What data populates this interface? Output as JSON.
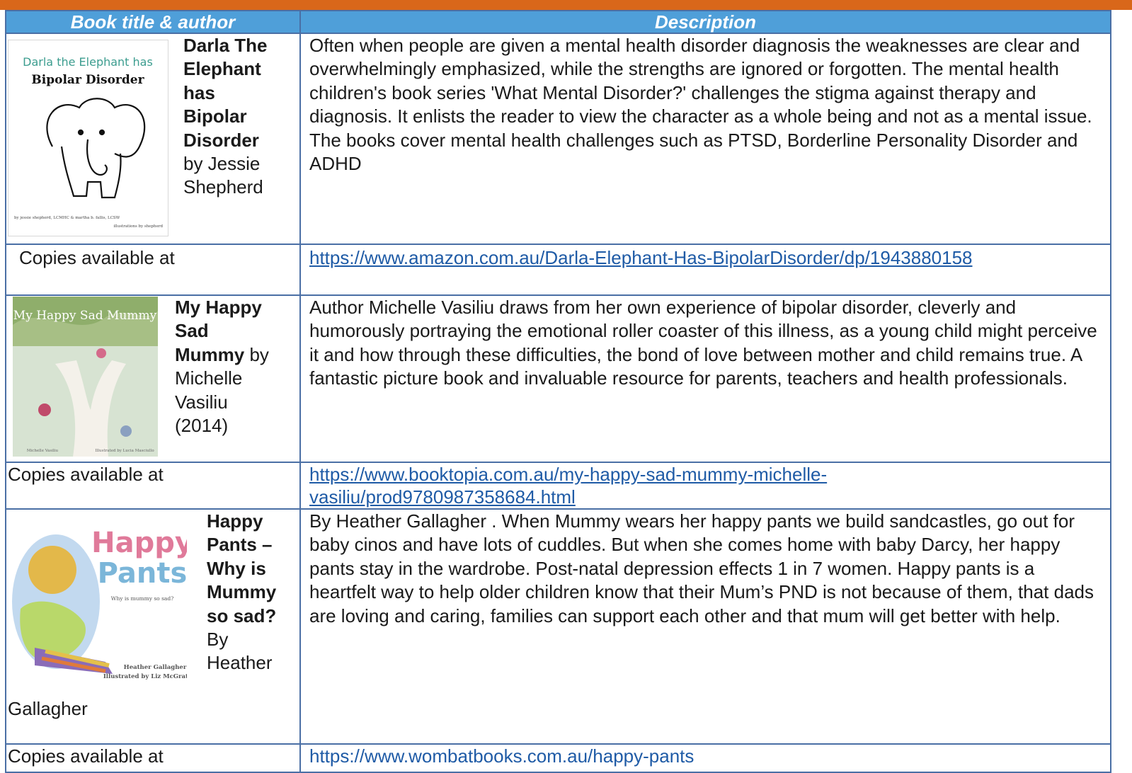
{
  "header": {
    "col1": "Book title & author",
    "col2": "Description"
  },
  "books": [
    {
      "cover": {
        "line1": "Darla the Elephant has",
        "line2": "Bipolar Disorder",
        "credit_left": "by jessie shepherd, LCMHC & martha b. fallis, LCSW",
        "credit_right": "illustrations by shepherd"
      },
      "title_lines": [
        "Darla The",
        "Elephant",
        "has",
        "Bipolar",
        "Disorder"
      ],
      "author_lines": [
        "by Jessie",
        "Shepherd"
      ],
      "description": "Often when people are given a mental health disorder diagnosis the weaknesses are clear and overwhelmingly emphasized, while the strengths are ignored or forgotten. The mental health children's book series 'What Mental Disorder?' challenges the stigma against therapy and diagnosis. It enlists the reader to view the character as a whole being and not as a mental issue. The books cover mental health challenges such as PTSD, Borderline Personality Disorder and ADHD",
      "copies_label": "Copies available at",
      "link": "https://www.amazon.com.au/Darla-Elephant-Has-BipolarDisorder/dp/1943880158"
    },
    {
      "cover": {
        "title": "My Happy Sad Mummy",
        "author": "Michelle Vasiliu",
        "illustrator": "Illustrated by Lucia Masciullo"
      },
      "title_lines": [
        "My Happy",
        "Sad",
        "Mummy"
      ],
      "author_first": " by",
      "author_lines": [
        "Michelle",
        "Vasiliu",
        "(2014)"
      ],
      "description": "Author Michelle Vasiliu draws from her own experience of bipolar disorder, cleverly and humorously portraying the emotional roller coaster of this illness, as a young child might perceive it and how through these difficulties, the bond of love between mother and child remains true. A fantastic picture book and invaluable resource for parents, teachers and health professionals.",
      "copies_label": "Copies available at",
      "link_line1": "https://www.booktopia.com.au/my-happy-sad-mummy-michelle-",
      "link_line2": "vasiliu/prod9780987358684.html"
    },
    {
      "cover": {
        "word1": "Happy",
        "word2": "Pants",
        "subtitle": "Why is mummy so sad?",
        "author": "Heather Gallagher",
        "illustrator": "Illustrated by Liz McGrath"
      },
      "title_lines": [
        "Happy",
        "Pants –",
        "Why is",
        "Mummy",
        "so sad?"
      ],
      "author_lines": [
        "By",
        "Heather"
      ],
      "author_tail": "Gallagher",
      "description": "By Heather Gallagher . When Mummy wears her happy pants we build sandcastles, go out for baby cinos and have lots of cuddles. But when she comes home with baby Darcy, her happy pants stay in the wardrobe. Post-natal depression effects 1 in 7 women. Happy pants is a heartfelt way to help older children know that their Mum’s PND is not because of them, that dads are loving and caring, families can support each other and that mum will get better with help.",
      "copies_label": "Copies available at",
      "link": "https://www.wombatbooks.com.au/happy-pants"
    }
  ],
  "colors": {
    "top_bar": "#d9671a",
    "header_bg": "#4f9fd9",
    "border": "#4a6fa5",
    "link": "#1f5ba6"
  }
}
